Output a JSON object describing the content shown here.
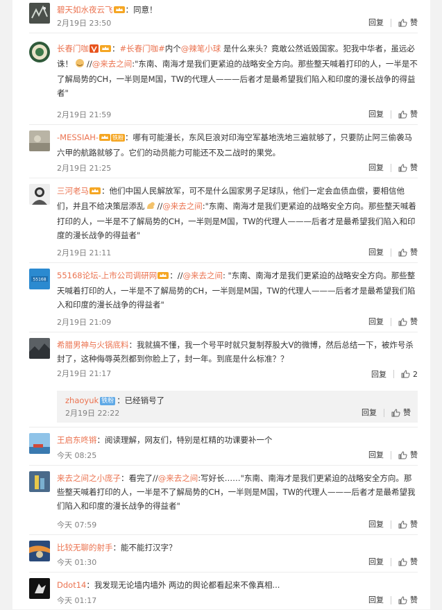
{
  "labels": {
    "reply": "回复",
    "like": "赞"
  },
  "colors": {
    "accent": "#eb7350",
    "text": "#333333",
    "time": "#808080",
    "reply_bg": "#f2f2f2"
  },
  "comments": [
    {
      "user": "碧天如水夜云飞",
      "content": "：同意！",
      "time": "2月19日 23:50",
      "likes": "赞"
    },
    {
      "user": "长春门咖",
      "prefix": "：",
      "tag": "#长春门咖#",
      "mid1": "内个",
      "m1": "@辣笔小球",
      "mid2": " 是什么来头？竟敢公然诋毁国家。犯我中华者，虽远必诛！",
      "sep2": "//",
      "m2": "@来去之间",
      "rest": ":\"东南、南海才是我们更紧迫的战略安全方向。那些整天喊着打印的人，一半是不了解局势的CH，一半则是M国，TW的代理人———后者才是最希望我们陷入和印度的漫长战争的得益者\"",
      "time": "2月19日 21:59",
      "likes": "赞"
    },
    {
      "user": "-MESSIAH-",
      "badge": "铁粉",
      "content": "：哪有可能漫长，东风巨浪对印海空军基地洗地三遍就够了，只要防止阿三偷袭马六甲的航路就够了。它们的动员能力可能还不及二战时的果党。",
      "time": "2月19日 21:25",
      "likes": "赞"
    },
    {
      "user": "三河老马",
      "content": "：他们中国人民解放军，可不是什么国家男子足球队，他们一定会血债血偿，要相信他们，并且不给决策层添乱",
      "sep2": "//",
      "m2": "@来去之间",
      "rest": ":\"东南、南海才是我们更紧迫的战略安全方向。那些整天喊着打印的人，一半是不了解局势的CH，一半则是M国，TW的代理人———后者才是最希望我们陷入和印度的漫长战争的得益者\"",
      "time": "2月19日 21:11",
      "likes": "赞"
    },
    {
      "user": "55168论坛-上市公司调研网",
      "content": "：",
      "sep2": "//",
      "m2": "@来去之间",
      "rest": ": \"东南、南海才是我们更紧迫的战略安全方向。那些整天喊着打印的人，一半是不了解局势的CH，一半则是M国，TW的代理人———后者才是最希望我们陷入和印度的漫长战争的得益者\"",
      "time": "2月19日 21:09",
      "likes": "赞"
    },
    {
      "user": "希腊男神与火锅底料",
      "content": "：我就搞不懂，我一个号平时就只复制荐股大V的微博，然后总结一下，被炸号杀封了，这种侮辱英烈都到你脸上了，封一年。到底是什么标准？？",
      "time": "2月19日 21:17",
      "likes": "2",
      "reply": {
        "user": "zhaoyuk",
        "badge": "铁粉",
        "content": "：已经销号了",
        "time": "2月19日 22:22",
        "likes": "赞"
      }
    },
    {
      "user": "王启东咚锵",
      "content": "：阅读理解，网友们，特别是杠精的功课要补一个",
      "time": "今天 08:25",
      "likes": "赞"
    },
    {
      "user": "来去之间之小庞子",
      "content": "：看完了",
      "sep2": "//",
      "m2": "@来去之间",
      "rest": ":写好长……\"东南、南海才是我们更紧迫的战略安全方向。那些整天喊着打印的人，一半是不了解局势的CH，一半则是M国，TW的代理人———后者才是最希望我们陷入和印度的漫长战争的得益者\"",
      "time": "今天 07:59",
      "likes": "赞"
    },
    {
      "user": "比较无聊的射手",
      "content": "：能不能打汉字？",
      "time": "今天 01:30",
      "likes": "赞"
    },
    {
      "user": "Ddot14",
      "content": "：我发现无论墙内墙外 两边的舆论都看起来不像真相...",
      "time": "今天 01:17",
      "likes": "赞"
    }
  ]
}
